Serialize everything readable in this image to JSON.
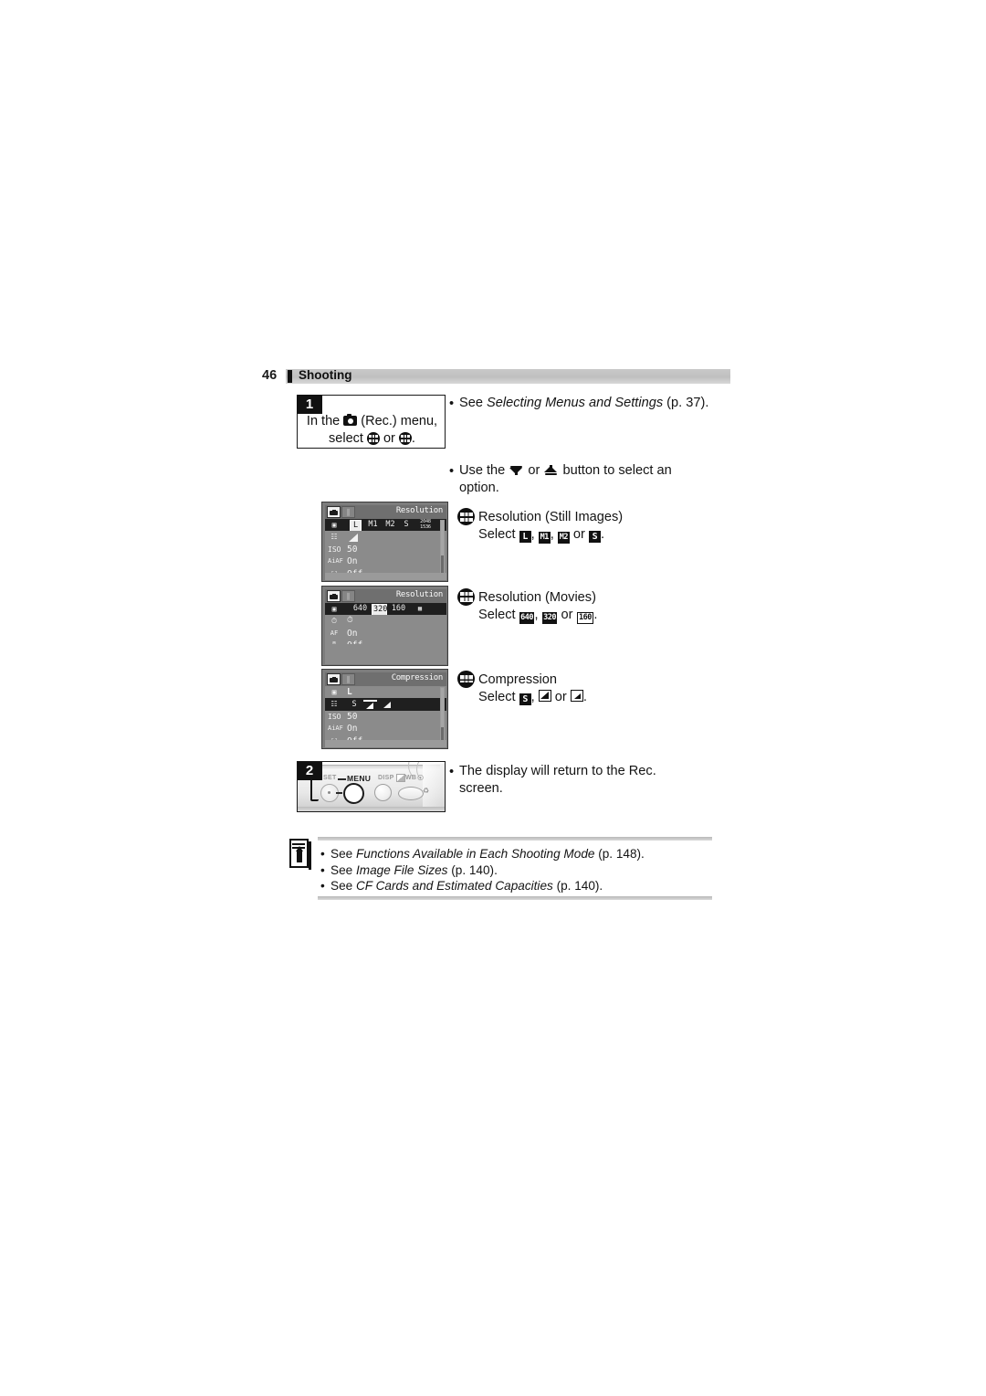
{
  "header": {
    "page_number": "46",
    "section_title": "Shooting"
  },
  "steps": [
    {
      "number": "1",
      "text_parts": {
        "before_camera": "In the ",
        "after_camera": " (Rec.) menu,",
        "line2_before": "select ",
        "line2_mid": " or ",
        "line2_after": "."
      },
      "icons": [
        "camera-rec-icon",
        "resolution-grid-icon",
        "compression-grid-icon"
      ]
    },
    {
      "number": "2",
      "camera_labels": {
        "set": "SET",
        "menu": "MENU",
        "disp": "DISP",
        "wb": "WB"
      }
    }
  ],
  "notes": {
    "see_menus": {
      "prefix": "See ",
      "italic": "Selecting Menus and Settings",
      "suffix": " (p. 37)."
    },
    "use_button": {
      "prefix": "Use the ",
      "mid": " or ",
      "suffix": " button to select an option."
    },
    "return_display": "The display will return to the Rec. screen."
  },
  "options": [
    {
      "id": "resolution-still",
      "icon": "resolution-grid-icon",
      "title": "Resolution (Still Images)",
      "select_label": "Select",
      "choices": [
        "L",
        "M1",
        "M2",
        "S"
      ],
      "joiner_comma": ", ",
      "joiner_or": " or ",
      "period": "."
    },
    {
      "id": "resolution-movies",
      "icon": "resolution-movies-grid-icon",
      "title": "Resolution (Movies)",
      "select_label": "Select",
      "choices": [
        "640",
        "320",
        "160"
      ],
      "joiner_comma": ", ",
      "joiner_or": " or ",
      "period": "."
    },
    {
      "id": "compression",
      "icon": "compression-grid-icon",
      "title": "Compression",
      "select_label": "Select",
      "choices": [
        "S",
        "wedge-fine",
        "wedge-normal"
      ],
      "joiner_comma": ", ",
      "joiner_or": " or ",
      "period": "."
    }
  ],
  "lcd_screens": [
    {
      "id": "lcd-resolution-still",
      "title": "Resolution",
      "tab_rec": "rec-tab-icon",
      "tab_setup": "setup-tab-icon",
      "selected_row": 0,
      "rows": [
        {
          "icon": "resolution-icon",
          "type": "options",
          "options": [
            "L",
            "M1",
            "M2",
            "S",
            "2048x1536"
          ],
          "selected": "L"
        },
        {
          "icon": "compression-icon",
          "type": "glyph",
          "value": "wedge-fine"
        },
        {
          "icon": "ISO",
          "type": "text",
          "value": "50"
        },
        {
          "icon": "AiAF",
          "type": "text",
          "value": "On"
        },
        {
          "icon": "review-icon",
          "type": "text",
          "value": "Off"
        }
      ]
    },
    {
      "id": "lcd-resolution-movies",
      "title": "Resolution",
      "tab_rec": "rec-tab-icon",
      "tab_setup": "setup-tab-icon",
      "selected_row": 0,
      "rows": [
        {
          "icon": "resolution-icon",
          "type": "options",
          "options": [
            "640",
            "320",
            "160",
            "movie-icon"
          ],
          "selected": "320"
        },
        {
          "icon": "self-timer-icon",
          "type": "glyph",
          "value": "self-timer"
        },
        {
          "icon": "AF",
          "type": "text",
          "value": "On"
        },
        {
          "icon": "my-camera-icon",
          "type": "text",
          "value": "Off"
        }
      ]
    },
    {
      "id": "lcd-compression",
      "title": "Compression",
      "tab_rec": "rec-tab-icon",
      "tab_setup": "setup-tab-icon",
      "selected_row": 1,
      "rows": [
        {
          "icon": "resolution-icon",
          "type": "text",
          "value": "L"
        },
        {
          "icon": "compression-icon",
          "type": "options",
          "options": [
            "S",
            "wedge-fine",
            "wedge-normal"
          ],
          "selected": "wedge-fine"
        },
        {
          "icon": "ISO",
          "type": "text",
          "value": "50"
        },
        {
          "icon": "AiAF",
          "type": "text",
          "value": "On"
        },
        {
          "icon": "review-icon",
          "type": "text",
          "value": "Off"
        }
      ]
    }
  ],
  "memo": {
    "icon": "memo-pencil-icon",
    "items": [
      {
        "prefix": "See ",
        "italic": "Functions Available in Each Shooting Mode",
        "suffix": " (p. 148)."
      },
      {
        "prefix": "See ",
        "italic": "Image File Sizes",
        "suffix": " (p. 140)."
      },
      {
        "prefix": "See ",
        "italic": "CF Cards and Estimated Capacities",
        "suffix": " (p. 140)."
      }
    ]
  },
  "colors": {
    "header_band": "#c4c4c4",
    "ink": "#111111",
    "lcd_background": "#8b8b8b",
    "lcd_selected": "#1f1f1f",
    "rule": "#c6c6c6"
  }
}
